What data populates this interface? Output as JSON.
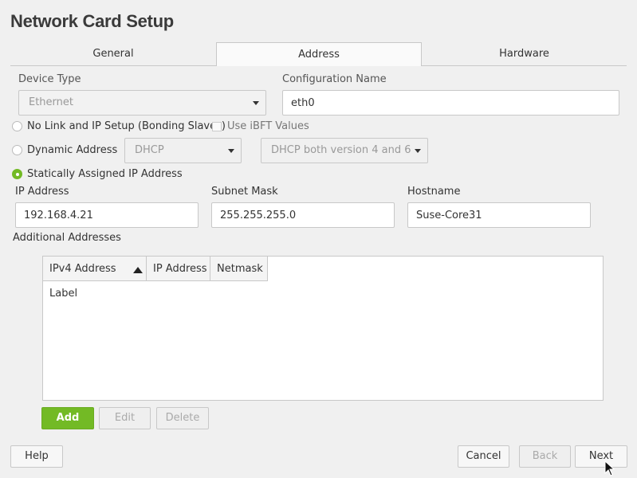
{
  "window": {
    "title": "Network Card Setup"
  },
  "tabs": [
    {
      "label": "General",
      "active": false
    },
    {
      "label": "Address",
      "active": true
    },
    {
      "label": "Hardware",
      "active": false
    }
  ],
  "device_type": {
    "label": "Device Type",
    "value": "Ethernet"
  },
  "config_name": {
    "label": "Configuration Name",
    "value": "eth0"
  },
  "options": {
    "no_link": "No Link and IP Setup (Bonding Slaves)",
    "use_ibft": "Use iBFT Values",
    "dynamic": "Dynamic Address",
    "dynamic_mode": "DHCP",
    "dhcp_version": "DHCP both version 4 and 6",
    "static": "Statically Assigned IP Address",
    "selected": "static"
  },
  "ip": {
    "label": "IP Address",
    "value": "192.168.4.21"
  },
  "subnet": {
    "label": "Subnet Mask",
    "value": "255.255.255.0"
  },
  "hostname": {
    "label": "Hostname",
    "value": "Suse-Core31"
  },
  "additional": {
    "label": "Additional Addresses",
    "columns": [
      "IPv4 Address Label",
      "IP Address",
      "Netmask"
    ],
    "rows": []
  },
  "table_buttons": {
    "add": "Add",
    "edit": "Edit",
    "delete": "Delete"
  },
  "footer": {
    "help": "Help",
    "cancel": "Cancel",
    "back": "Back",
    "next": "Next"
  },
  "colors": {
    "accent": "#73ba25",
    "background": "#f0f0f0"
  }
}
